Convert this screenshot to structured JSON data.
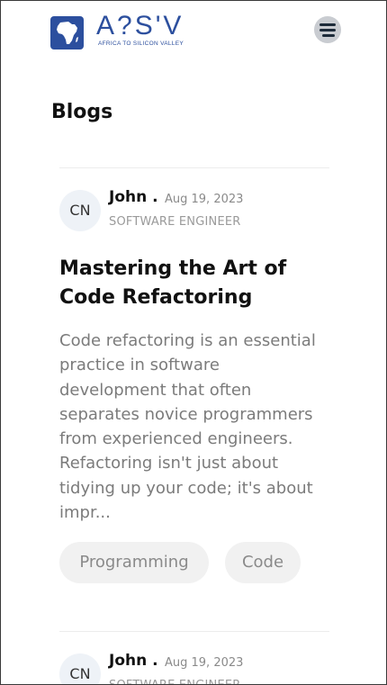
{
  "header": {
    "logo_text": "A?S'V",
    "logo_subtitle": "AFRICA TO SILICON VALLEY",
    "menu_icon": "hamburger-menu-icon",
    "brand_color": "#2c4f9e"
  },
  "page": {
    "title": "Blogs"
  },
  "posts": [
    {
      "avatar_initials": "CN",
      "author": "John .",
      "date": "Aug 19, 2023",
      "role": "SOFTWARE ENGINEER",
      "title": "Mastering the Art of Code Refactoring",
      "excerpt": "Code refactoring is an essential practice in software development that often separates novice programmers from experienced engineers. Refactoring isn't just about tidying up your code; it's about impr...",
      "tags": [
        "Programming",
        "Code"
      ]
    },
    {
      "avatar_initials": "CN",
      "author": "John .",
      "date": "Aug 19, 2023",
      "role": "SOFTWARE ENGINEER"
    }
  ]
}
